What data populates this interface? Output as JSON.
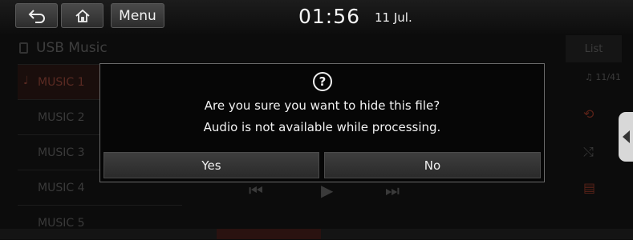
{
  "status_bar": {
    "back_icon": "back-arrow-icon",
    "home_icon": "home-icon",
    "menu_label": "Menu",
    "time": "01:56",
    "date": "11 Jul."
  },
  "player": {
    "source_title": "USB Music",
    "list_label": "List",
    "tracks": [
      {
        "label": "MUSIC 1"
      },
      {
        "label": "MUSIC 2"
      },
      {
        "label": "MUSIC 3"
      },
      {
        "label": "MUSIC 4"
      },
      {
        "label": "MUSIC 5"
      }
    ],
    "track_counter": "♫ 11/41"
  },
  "dialog": {
    "message_line1": "Are you sure you want to hide this file?",
    "message_line2": "Audio is not available while processing.",
    "yes_label": "Yes",
    "no_label": "No",
    "icon": "question-icon"
  }
}
